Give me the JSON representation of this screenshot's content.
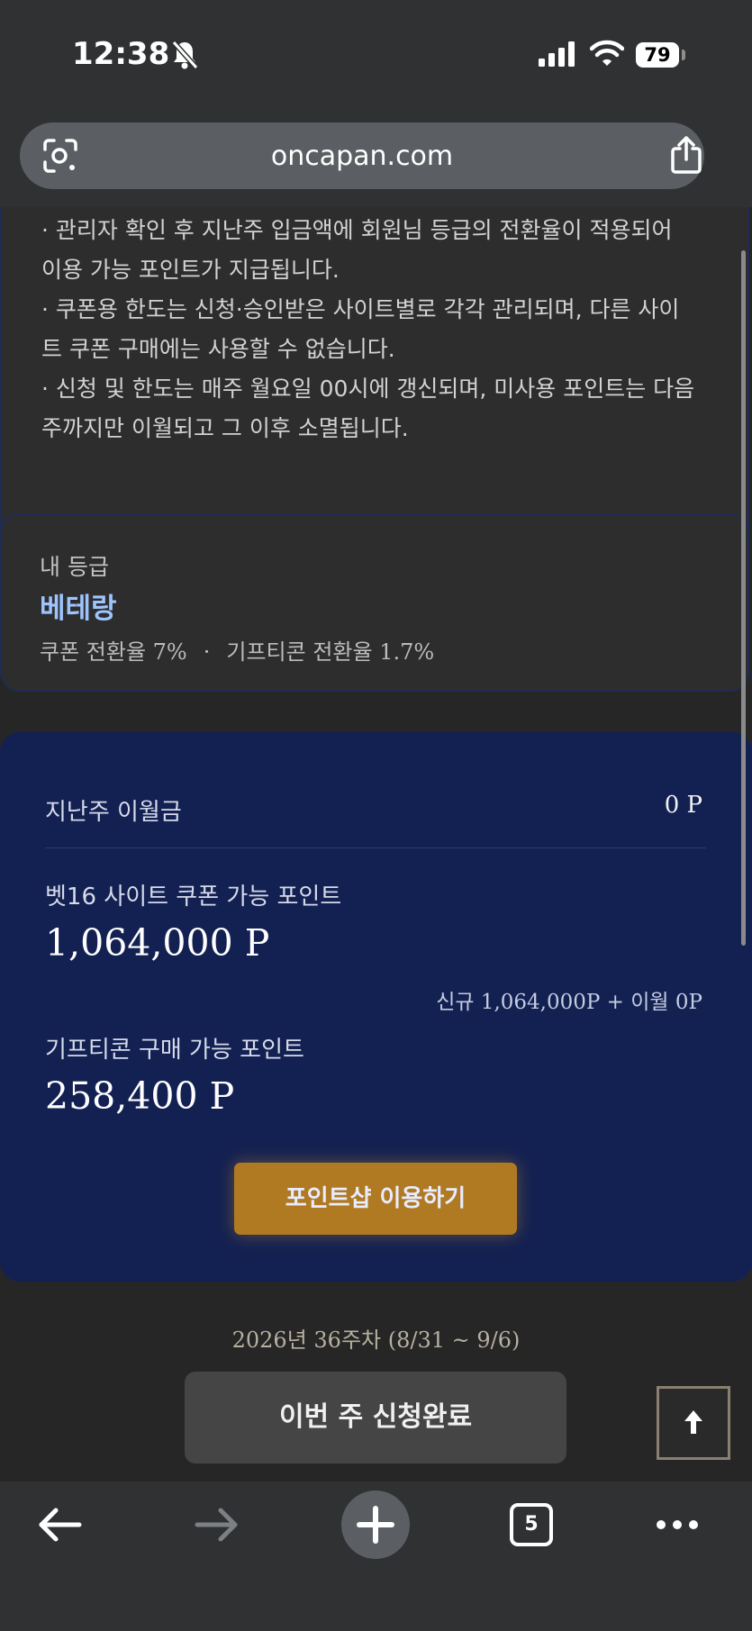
{
  "status_bar": {
    "time": "12:38",
    "battery": "79"
  },
  "browser": {
    "url": "oncapan.com",
    "tab_count": "5"
  },
  "notice": {
    "lines": [
      "· 관리자 확인 후 지난주 입금액에 회원님 등급의 전환율이 적용되어",
      "이용 가능 포인트가 지급됩니다.",
      "· 쿠폰용 한도는 신청·승인받은 사이트별로 각각 관리되며, 다른 사이",
      "트 쿠폰 구매에는 사용할 수 없습니다.",
      "· 신청 및 한도는 매주 월요일 00시에 갱신되며, 미사용 포인트는 다음",
      "주까지만 이월되고 그 이후 소멸됩니다."
    ]
  },
  "grade": {
    "label": "내 등급",
    "name": "베테랑",
    "coupon_rate": "쿠폰 전환율 7%",
    "separator": "·",
    "gift_rate": "기프티콘 전환율 1.7%"
  },
  "points": {
    "carryover_label": "지난주 이월금",
    "carryover_value": "0 P",
    "coupon_label": "벳16 사이트 쿠폰 가능 포인트",
    "coupon_value": "1,064,000 P",
    "coupon_breakdown": "신규 1,064,000P + 이월 0P",
    "gift_label": "기프티콘 구매 가능 포인트",
    "gift_value": "258,400 P",
    "shop_button": "포인트샵 이용하기"
  },
  "week_label": "2026년 36주차 (8/31 ~ 9/6)",
  "apply_button": "이번 주 신청완료",
  "icons": {
    "scroll_top": "arrow-up-icon",
    "back": "arrow-left-icon",
    "forward": "arrow-right-icon",
    "new_tab": "plus-icon",
    "more": "more-icon",
    "share": "share-icon",
    "lens": "lens-icon"
  },
  "colors": {
    "points_card": "#132152",
    "shop_button": "#b07a22",
    "grade_name": "#9ec4ff"
  }
}
